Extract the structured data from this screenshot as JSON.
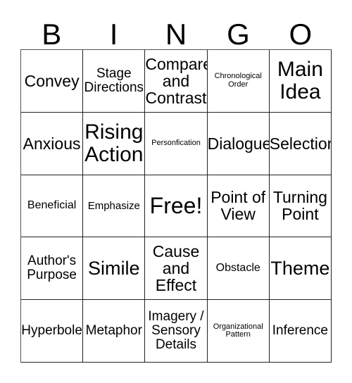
{
  "card": {
    "title": "BINGO",
    "header_letters": [
      "B",
      "I",
      "N",
      "G",
      "O"
    ],
    "columns": 5,
    "rows": 5,
    "colors": {
      "background": "#ffffff",
      "text": "#000000",
      "border": "#222222"
    },
    "cells": [
      {
        "label": "Convey",
        "size": "m",
        "row": 1,
        "col": 1,
        "free": false
      },
      {
        "label": "Stage\nDirections",
        "size": "s",
        "row": 1,
        "col": 2,
        "free": false
      },
      {
        "label": "Compare\nand\nContrast",
        "size": "m",
        "row": 1,
        "col": 3,
        "free": false
      },
      {
        "label": "Chronological\nOrder",
        "size": "tiny",
        "row": 1,
        "col": 4,
        "free": false
      },
      {
        "label": "Main\nIdea",
        "size": "xl",
        "row": 1,
        "col": 5,
        "free": false
      },
      {
        "label": "Anxious",
        "size": "m",
        "row": 2,
        "col": 1,
        "free": false
      },
      {
        "label": "Rising\nAction",
        "size": "xl",
        "row": 2,
        "col": 2,
        "free": false
      },
      {
        "label": "Personfication",
        "size": "tiny",
        "row": 2,
        "col": 3,
        "free": false
      },
      {
        "label": "Dialogue",
        "size": "m",
        "row": 2,
        "col": 4,
        "free": false
      },
      {
        "label": "Selection",
        "size": "m",
        "row": 2,
        "col": 5,
        "free": false
      },
      {
        "label": "Beneficial",
        "size": "xs",
        "row": 3,
        "col": 1,
        "free": false
      },
      {
        "label": "Emphasize",
        "size": "xxs",
        "row": 3,
        "col": 2,
        "free": false
      },
      {
        "label": "Free!",
        "size": "xxl",
        "row": 3,
        "col": 3,
        "free": true
      },
      {
        "label": "Point of\nView",
        "size": "m",
        "row": 3,
        "col": 4,
        "free": false
      },
      {
        "label": "Turning\nPoint",
        "size": "m",
        "row": 3,
        "col": 5,
        "free": false
      },
      {
        "label": "Author's\nPurpose",
        "size": "s",
        "row": 4,
        "col": 1,
        "free": false
      },
      {
        "label": "Simile",
        "size": "l",
        "row": 4,
        "col": 2,
        "free": false
      },
      {
        "label": "Cause\nand\nEffect",
        "size": "m",
        "row": 4,
        "col": 3,
        "free": false
      },
      {
        "label": "Obstacle",
        "size": "xs",
        "row": 4,
        "col": 4,
        "free": false
      },
      {
        "label": "Theme",
        "size": "l",
        "row": 4,
        "col": 5,
        "free": false
      },
      {
        "label": "Hyperbole",
        "size": "s",
        "row": 5,
        "col": 1,
        "free": false
      },
      {
        "label": "Metaphor",
        "size": "s",
        "row": 5,
        "col": 2,
        "free": false
      },
      {
        "label": "Imagery /\nSensory\nDetails",
        "size": "s",
        "row": 5,
        "col": 3,
        "free": false
      },
      {
        "label": "Organizational\nPattern",
        "size": "tiny",
        "row": 5,
        "col": 4,
        "free": false
      },
      {
        "label": "Inference",
        "size": "s",
        "row": 5,
        "col": 5,
        "free": false
      }
    ]
  }
}
